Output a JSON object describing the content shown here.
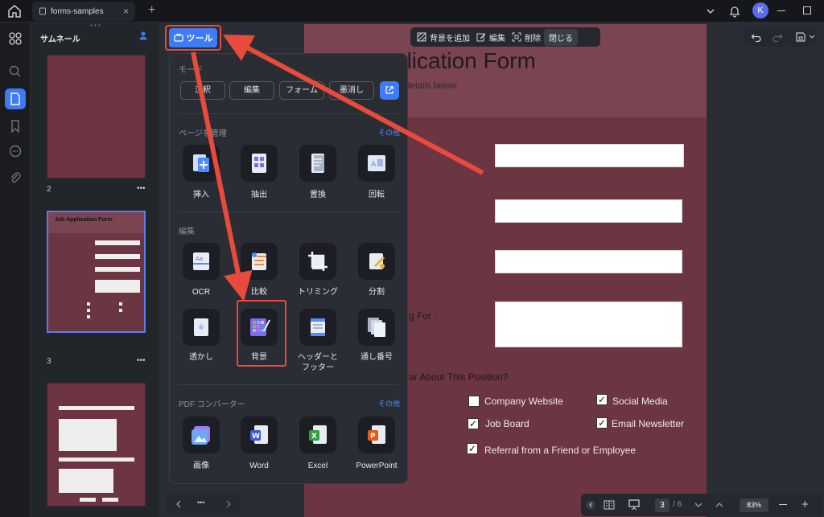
{
  "titlebar": {
    "tab_title": "forms-samples",
    "tab_close": "×",
    "add_tab": "+",
    "avatar_initial": "K"
  },
  "thumbnails": {
    "title": "サムネール",
    "pages": [
      {
        "number": "2",
        "more": "•••"
      },
      {
        "number": "3",
        "more": "•••"
      }
    ],
    "thumb3_title": "Job Application Form"
  },
  "document": {
    "title": "plication Form",
    "subtitle": "r details below.",
    "label_applying_for": "g For :",
    "label_hear_about": "ar About This Position?",
    "checkboxes": [
      {
        "label": "Company Website",
        "checked": false
      },
      {
        "label": "Social Media",
        "checked": true
      },
      {
        "label": "Job Board",
        "checked": true
      },
      {
        "label": "Email Newsletter",
        "checked": true
      },
      {
        "label": "Referral from a Friend or Employee",
        "checked": true
      }
    ]
  },
  "bg_toolbar": {
    "add_background": "背景を追加",
    "edit": "編集",
    "delete": "削除",
    "close": "閉じる"
  },
  "tools_button": "ツール",
  "tools_panel": {
    "mode_title": "モード",
    "modes": [
      "注釈",
      "編集",
      "フォーム",
      "墨消し"
    ],
    "page_section_title": "ページを管理",
    "page_section_more": "その他",
    "page_tools": [
      "挿入",
      "抽出",
      "置換",
      "回転"
    ],
    "edit_section_title": "編集",
    "edit_tools_row1": [
      "OCR",
      "比較",
      "トリミング",
      "分割"
    ],
    "edit_tools_row2": [
      "透かし",
      "背景",
      "ヘッダーと\nフッター",
      "通し番号"
    ],
    "converter_title": "PDF コンバーター",
    "converter_more": "その他",
    "converters": [
      "画像",
      "Word",
      "Excel",
      "PowerPoint"
    ]
  },
  "bottom": {
    "page_current": "3",
    "page_total": "/ 6",
    "zoom": "83%",
    "ellipsis": "•••"
  },
  "colors": {
    "accent": "#3d7cf5",
    "highlight": "#e84b3c",
    "page_bg": "#6b3542"
  }
}
